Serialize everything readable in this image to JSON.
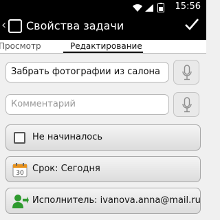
{
  "status_bar": {
    "time": "15:56",
    "icons": [
      "wifi-icon",
      "signal-icon",
      "battery-icon"
    ]
  },
  "action_bar": {
    "title": "Свойства задачи",
    "back_icon": "chevron-left-icon",
    "confirm_icon": "checkmark-icon"
  },
  "tabs": [
    {
      "label": "Просмотр",
      "selected": false
    },
    {
      "label": "Редактирование",
      "selected": true
    }
  ],
  "form": {
    "title_value": "Забрать фотографии из салона",
    "comment_placeholder": "Комментарий",
    "mic_icon": "microphone-icon"
  },
  "buttons": {
    "status_label": "Не начиналось",
    "due_label": "Срок: Сегодня",
    "assignee_label": "Исполнитель: ivanova.anna@mail.ru"
  },
  "colors": {
    "bar_background": "#000000",
    "calendar_accent": "#e8921c",
    "assignee_accent": "#2e9a2e"
  }
}
